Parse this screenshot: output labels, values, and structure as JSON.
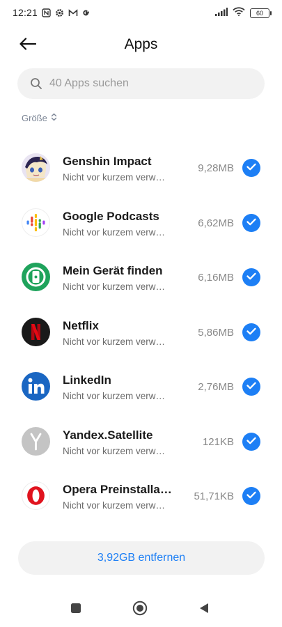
{
  "status": {
    "time": "12:21",
    "battery": "60",
    "left_icons": [
      "nfc-icon",
      "gear-icon",
      "gmail-icon",
      "google-icon"
    ],
    "right_icons": [
      "signal-icon",
      "wifi-icon",
      "battery-icon"
    ]
  },
  "header": {
    "title": "Apps",
    "back_icon": "arrow-left-icon"
  },
  "search": {
    "placeholder": "40 Apps suchen",
    "value": ""
  },
  "sort": {
    "label": "Größe",
    "icon": "sort-chevrons-icon"
  },
  "apps": [
    {
      "name": "Genshin Impact",
      "sub": "Nicht vor kurzem verwendet",
      "size": "9,28MB",
      "icon": "genshin-impact-icon",
      "checked": true
    },
    {
      "name": "Google Podcasts",
      "sub": "Nicht vor kurzem verwendet",
      "size": "6,62MB",
      "icon": "google-podcasts-icon",
      "checked": true
    },
    {
      "name": "Mein Gerät finden",
      "sub": "Nicht vor kurzem verwendet",
      "size": "6,16MB",
      "icon": "find-my-device-icon",
      "checked": true
    },
    {
      "name": "Netflix",
      "sub": "Nicht vor kurzem verwendet",
      "size": "5,86MB",
      "icon": "netflix-icon",
      "checked": true
    },
    {
      "name": "LinkedIn",
      "sub": "Nicht vor kurzem verwendet",
      "size": "2,76MB",
      "icon": "linkedin-icon",
      "checked": true
    },
    {
      "name": "Yandex.Satellite",
      "sub": "Nicht vor kurzem verwendet",
      "size": "121KB",
      "icon": "yandex-satellite-icon",
      "checked": true
    },
    {
      "name": "Opera Preinstallation",
      "sub": "Nicht vor kurzem verwendet",
      "size": "51,71KB",
      "icon": "opera-icon",
      "checked": true
    }
  ],
  "action": {
    "label": "3,92GB entfernen"
  },
  "colors": {
    "accent": "#1d7ff5",
    "background": "#ffffff",
    "chip": "#f2f2f2"
  },
  "navbar": {
    "icons": [
      "recents-square-icon",
      "home-circle-icon",
      "back-triangle-icon"
    ]
  }
}
